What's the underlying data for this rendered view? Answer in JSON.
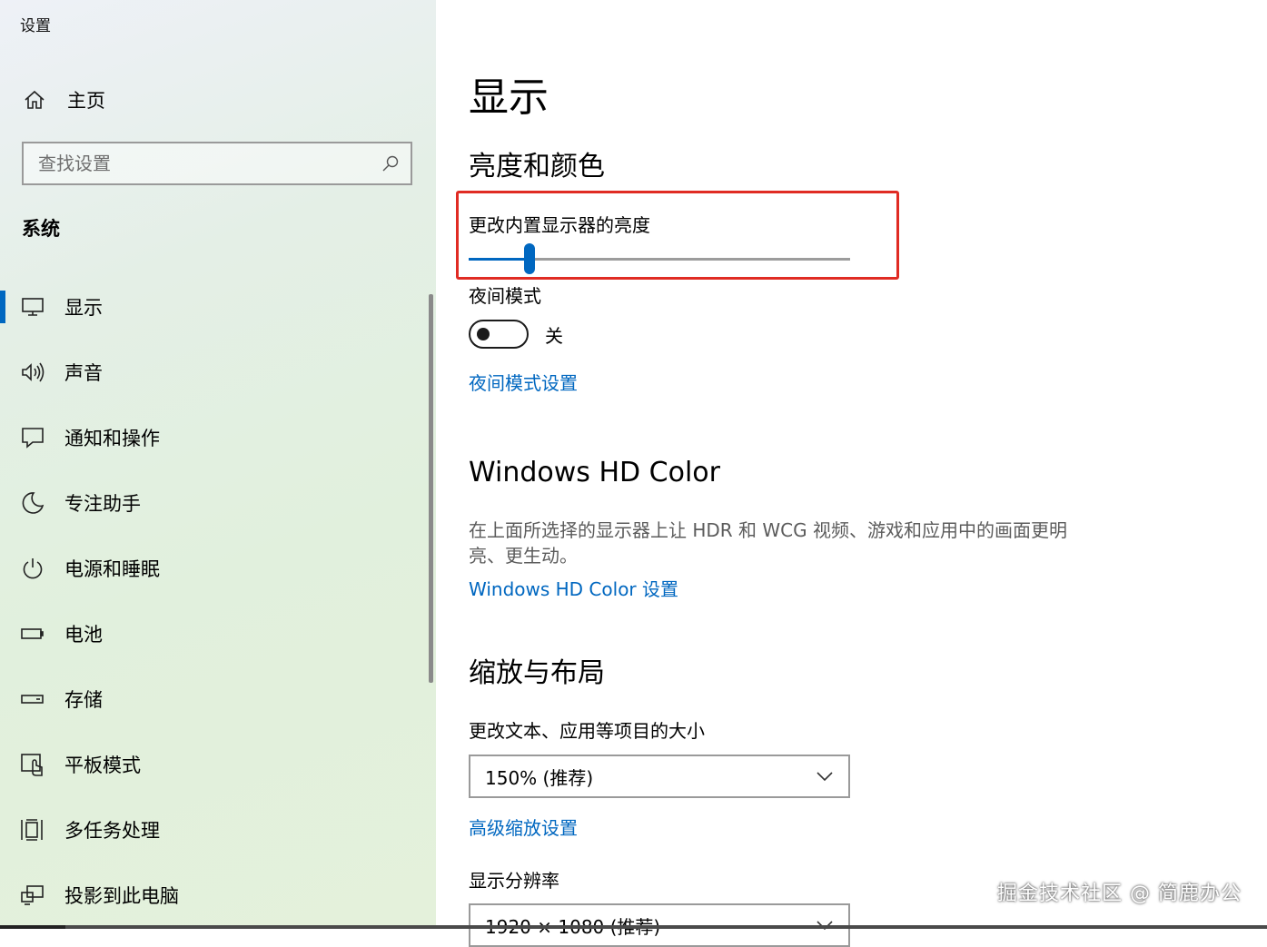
{
  "window": {
    "title": "设置"
  },
  "sidebar": {
    "home": {
      "label": "主页",
      "icon": "home-icon"
    },
    "search": {
      "placeholder": "查找设置",
      "icon": "search-icon"
    },
    "section": "系统",
    "items": [
      {
        "label": "显示",
        "icon": "monitor-icon",
        "active": true
      },
      {
        "label": "声音",
        "icon": "speaker-icon"
      },
      {
        "label": "通知和操作",
        "icon": "message-icon"
      },
      {
        "label": "专注助手",
        "icon": "moon-icon"
      },
      {
        "label": "电源和睡眠",
        "icon": "power-icon"
      },
      {
        "label": "电池",
        "icon": "battery-icon"
      },
      {
        "label": "存储",
        "icon": "storage-icon"
      },
      {
        "label": "平板模式",
        "icon": "tablet-icon"
      },
      {
        "label": "多任务处理",
        "icon": "multitask-icon"
      },
      {
        "label": "投影到此电脑",
        "icon": "project-icon"
      }
    ]
  },
  "main": {
    "title": "显示",
    "brightness_section": {
      "heading": "亮度和颜色",
      "brightness_label": "更改内置显示器的亮度",
      "brightness_value": 0.16,
      "night_mode_label": "夜间模式",
      "night_mode_state": "关",
      "night_mode_on": false,
      "night_mode_settings_link": "夜间模式设置"
    },
    "hdr_section": {
      "heading": "Windows HD Color",
      "description": "在上面所选择的显示器上让 HDR 和 WCG 视频、游戏和应用中的画面更明亮、更生动。",
      "link": "Windows HD Color 设置"
    },
    "scale_section": {
      "heading": "缩放与布局",
      "scale_label": "更改文本、应用等项目的大小",
      "scale_value": "150% (推荐)",
      "advanced_link": "高级缩放设置",
      "resolution_label": "显示分辨率",
      "resolution_value": "1920 × 1080 (推荐)"
    }
  },
  "watermark": "掘金技术社区 @ 简鹿办公",
  "colors": {
    "accent": "#0067c0",
    "highlight": "#e02b23"
  }
}
